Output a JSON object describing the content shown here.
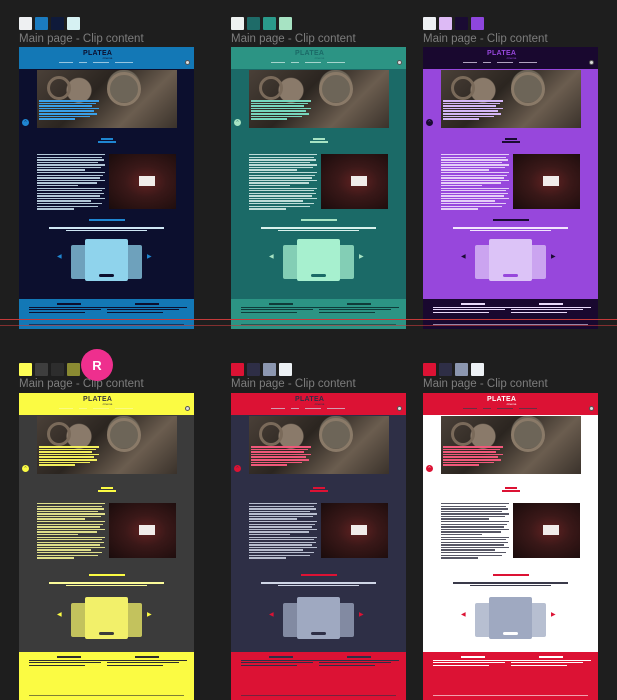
{
  "frame_label": "Main page - Clip content",
  "avatar_letter": "R",
  "logo": {
    "name": "PLATEA",
    "sub": "cinema"
  },
  "frames": [
    {
      "id": "blue",
      "swatches": [
        "#eef0f2",
        "#1b7bbf",
        "#0f1a3a",
        "#d6f1f3"
      ],
      "colors": {
        "header": "#1378b6",
        "body": "#0c0f2e",
        "accent": "#1f86d1",
        "text": "#cfe6f4",
        "hero_overlay": "#3aa0e8",
        "footer": "#1378b6",
        "footer_text": "#0c0f2e",
        "card": "#8fd3ec"
      }
    },
    {
      "id": "teal",
      "swatches": [
        "#eef2f1",
        "#1e6b68",
        "#2a9a8a",
        "#a7e3c3"
      ],
      "colors": {
        "header": "#2c9484",
        "body": "#1b6a67",
        "accent": "#a7e3c3",
        "text": "#d9f1ec",
        "hero_overlay": "#77d6bd",
        "footer": "#2c9484",
        "footer_text": "#0f3b39",
        "card": "#a7f0cf"
      }
    },
    {
      "id": "purple",
      "swatches": [
        "#eef0f4",
        "#ddbaf5",
        "#1a0b33",
        "#8e46dd"
      ],
      "colors": {
        "header": "#19082f",
        "body": "#9747dc",
        "accent": "#1a0b33",
        "text": "#f2e6fd",
        "hero_overlay": "#d4b7f7",
        "footer": "#19082f",
        "footer_text": "#e9dafa",
        "card": "#dcc3f7"
      }
    },
    {
      "id": "yellow",
      "swatches": [
        "#fefe55",
        "#3e3e3e",
        "#2d2d2d",
        "#8a8a32"
      ],
      "colors": {
        "header": "#fbfb43",
        "body": "#3b3b3b",
        "accent": "#fbfb43",
        "text": "#fbfb9a",
        "hero_overlay": "#f3ef5c",
        "footer": "#fbfb43",
        "footer_text": "#2d2d2d",
        "card": "#f2f06a"
      }
    },
    {
      "id": "red-dark",
      "swatches": [
        "#dc1234",
        "#2e2e46",
        "#8c97b0",
        "#edf1f5"
      ],
      "colors": {
        "header": "#dc1234",
        "body": "#2e2f46",
        "accent": "#dc1234",
        "text": "#cfd6e6",
        "hero_overlay": "#f0587a",
        "footer": "#dc1234",
        "footer_text": "#2e2f46",
        "card": "#9fa9c1"
      }
    },
    {
      "id": "red-light",
      "swatches": [
        "#dc1234",
        "#2e2e46",
        "#8c97b0",
        "#edf1f5"
      ],
      "colors": {
        "header": "#dc1234",
        "body": "#ffffff",
        "accent": "#dc1234",
        "text": "#3a3a4a",
        "hero_overlay": "#f0587a",
        "footer": "#dc1234",
        "footer_text": "#ffffff",
        "card": "#9fa9c1"
      }
    }
  ]
}
